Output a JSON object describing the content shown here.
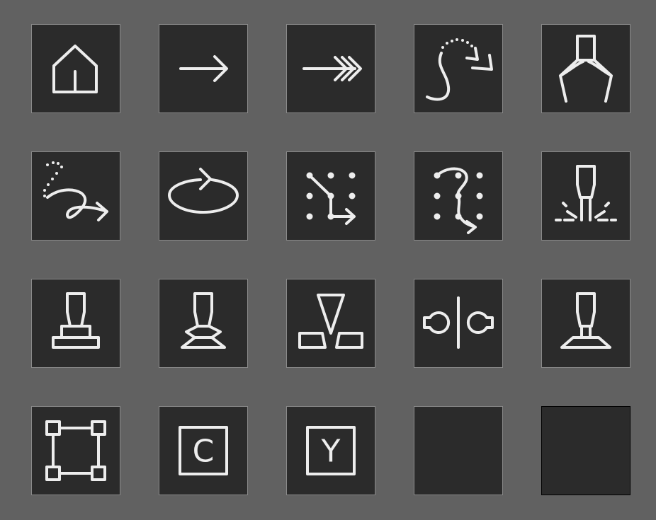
{
  "background_color": "#616161",
  "tile_color": "#2b2b2b",
  "icon_color": "#ededed",
  "tiles": [
    {
      "icon": "home-icon"
    },
    {
      "icon": "arrow-right-icon"
    },
    {
      "icon": "double-arrow-right-icon"
    },
    {
      "icon": "curved-path-return-icon"
    },
    {
      "icon": "gripper-icon"
    },
    {
      "icon": "freeform-path-arrow-icon"
    },
    {
      "icon": "rotate-ellipse-icon"
    },
    {
      "icon": "grid-path-arrow-icon"
    },
    {
      "icon": "grid-curved-path-icon"
    },
    {
      "icon": "spray-nozzle-icon"
    },
    {
      "icon": "tool-on-stand-icon"
    },
    {
      "icon": "tool-pinch-icon"
    },
    {
      "icon": "tool-triangle-blocks-icon"
    },
    {
      "icon": "mirror-symmetry-icon"
    },
    {
      "icon": "tool-on-platform-icon"
    },
    {
      "icon": "bounding-box-icon"
    },
    {
      "icon": "letter-c-box-icon",
      "label": "C"
    },
    {
      "icon": "letter-y-box-icon",
      "label": "Y"
    },
    {
      "icon": "empty-tile"
    },
    {
      "icon": "empty-tile-selected"
    }
  ]
}
